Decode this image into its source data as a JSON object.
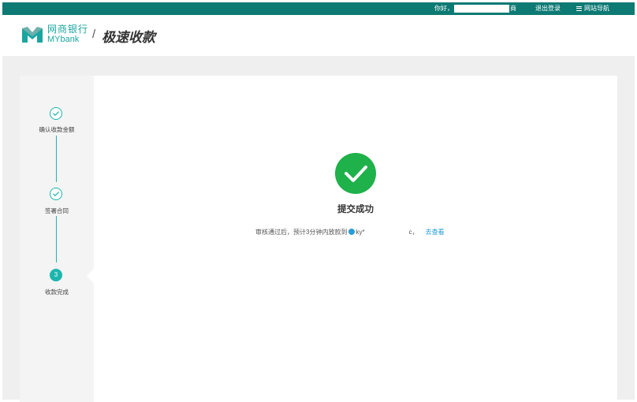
{
  "topbar": {
    "greeting": "你好，",
    "greeting_suffix": "商",
    "logout": "退出登录",
    "nav": "网站导航"
  },
  "brand": {
    "cn": "网商银行",
    "en": "MYbank",
    "separator": "/",
    "page_title": "极速收款"
  },
  "steps": [
    {
      "label": "确认收款金额",
      "status": "done"
    },
    {
      "label": "签署合同",
      "status": "done"
    },
    {
      "label": "收款完成",
      "status": "active",
      "number": "3"
    }
  ],
  "result": {
    "title": "提交成功",
    "message": "审核通过后，预计3分钟内放款到",
    "account": "ky*",
    "account_tail": "c，",
    "link": "去查看"
  },
  "colors": {
    "topbar": "#0d7a74",
    "accent": "#1cb6ae",
    "success": "#1fb14a",
    "link": "#1a9bd6"
  }
}
